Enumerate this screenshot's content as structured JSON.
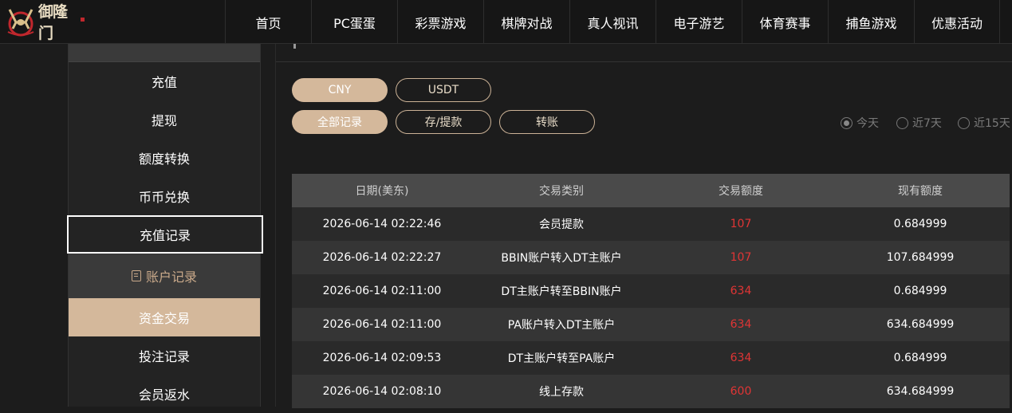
{
  "header": {
    "logo_text": "御隆门",
    "nav": [
      "首页",
      "PC蛋蛋",
      "彩票游戏",
      "棋牌对战",
      "真人视讯",
      "电子游艺",
      "体育赛事",
      "捕鱼游戏",
      "优惠活动"
    ]
  },
  "sidebar": {
    "items_top": [
      "充值",
      "提现",
      "额度转换",
      "币币兑换",
      "充值记录"
    ],
    "group_label": "账户记录",
    "items_bottom": [
      "资金交易",
      "投注记录",
      "会员返水"
    ]
  },
  "filters": {
    "currency": [
      "CNY",
      "USDT"
    ],
    "types": [
      "全部记录",
      "存/提款",
      "转账"
    ],
    "ranges": [
      "今天",
      "近7天",
      "近15天"
    ]
  },
  "table": {
    "headers": [
      "日期(美东)",
      "交易类别",
      "交易额度",
      "现有额度"
    ],
    "rows": [
      [
        "2026-06-14 02:22:46",
        "会员提款",
        "107",
        "0.684999"
      ],
      [
        "2026-06-14 02:22:27",
        "BBIN账户转入DT主账户",
        "107",
        "107.684999"
      ],
      [
        "2026-06-14 02:11:00",
        "DT主账户转至BBIN账户",
        "634",
        "0.684999"
      ],
      [
        "2026-06-14 02:11:00",
        "PA账户转入DT主账户",
        "634",
        "634.684999"
      ],
      [
        "2026-06-14 02:09:53",
        "DT主账户转至PA账户",
        "634",
        "0.684999"
      ],
      [
        "2026-06-14 02:08:10",
        "线上存款",
        "600",
        "634.684999"
      ]
    ]
  },
  "colors": {
    "accent": "#d4b89b",
    "amount_red": "#e03535"
  }
}
